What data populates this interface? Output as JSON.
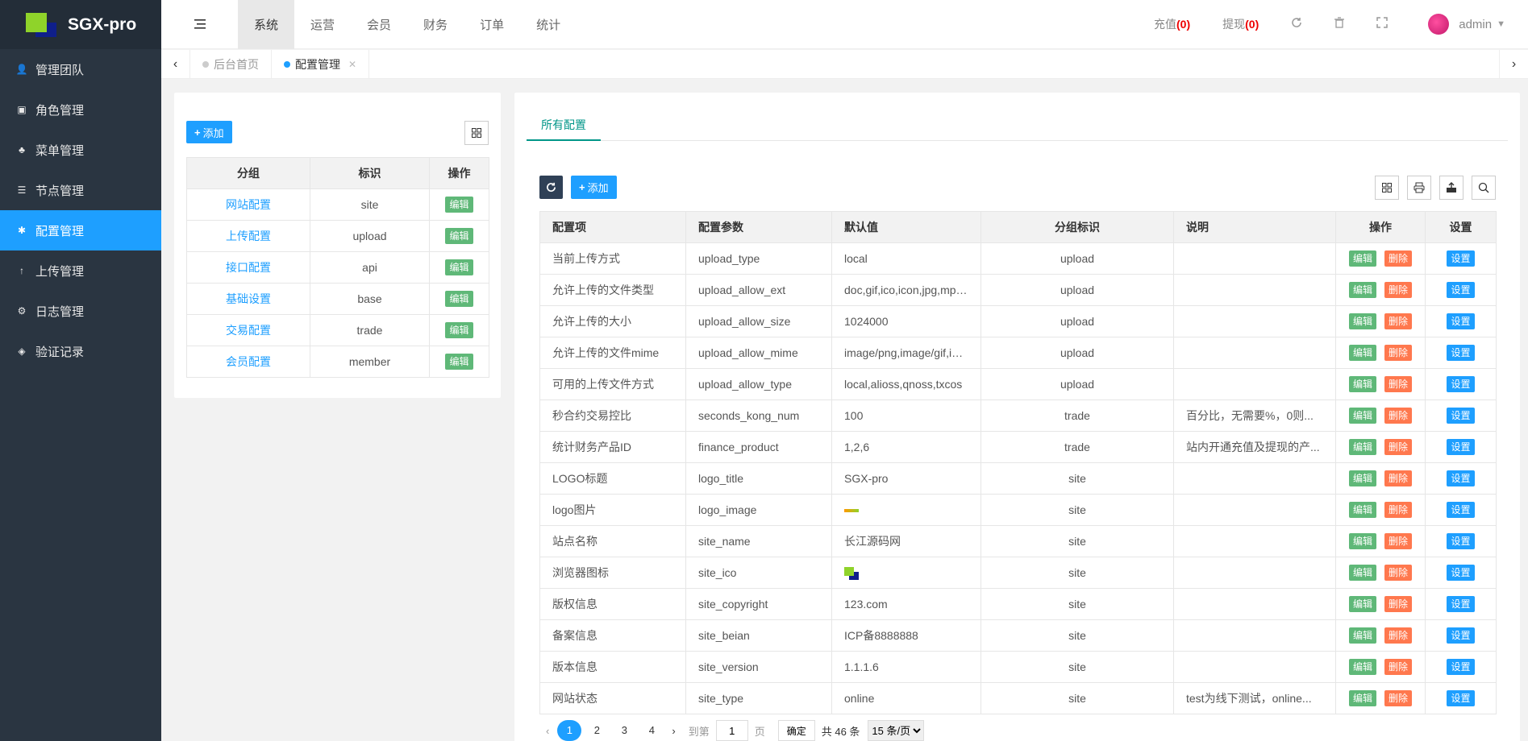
{
  "brand": {
    "name": "SGX-pro"
  },
  "sidebar": {
    "items": [
      {
        "label": "管理团队",
        "icon": "user-icon",
        "active": false
      },
      {
        "label": "角色管理",
        "icon": "role-icon",
        "active": false
      },
      {
        "label": "菜单管理",
        "icon": "tree-icon",
        "active": false
      },
      {
        "label": "节点管理",
        "icon": "list-icon",
        "active": false
      },
      {
        "label": "配置管理",
        "icon": "asterisk-icon",
        "active": true
      },
      {
        "label": "上传管理",
        "icon": "arrow-up-icon",
        "active": false
      },
      {
        "label": "日志管理",
        "icon": "gear-icon",
        "active": false
      },
      {
        "label": "验证记录",
        "icon": "cube-icon",
        "active": false
      }
    ]
  },
  "header": {
    "tabs": [
      {
        "label": "系统",
        "active": true
      },
      {
        "label": "运营",
        "active": false
      },
      {
        "label": "会员",
        "active": false
      },
      {
        "label": "财务",
        "active": false
      },
      {
        "label": "订单",
        "active": false
      },
      {
        "label": "统计",
        "active": false
      }
    ],
    "recharge_label": "充值",
    "recharge_count": "(0)",
    "withdraw_label": "提现",
    "withdraw_count": "(0)",
    "user": "admin"
  },
  "tabbar": {
    "tabs": [
      {
        "label": "后台首页",
        "active": false,
        "closable": false
      },
      {
        "label": "配置管理",
        "active": true,
        "closable": true
      }
    ]
  },
  "left_panel": {
    "add_label": "添加",
    "columns": [
      "分组",
      "标识",
      "操作"
    ],
    "edit_label": "编辑",
    "rows": [
      {
        "group": "网站配置",
        "key": "site"
      },
      {
        "group": "上传配置",
        "key": "upload"
      },
      {
        "group": "接口配置",
        "key": "api"
      },
      {
        "group": "基础设置",
        "key": "base"
      },
      {
        "group": "交易配置",
        "key": "trade"
      },
      {
        "group": "会员配置",
        "key": "member"
      }
    ]
  },
  "right_panel": {
    "tab_label": "所有配置",
    "add_label": "添加",
    "columns": [
      "配置项",
      "配置参数",
      "默认值",
      "分组标识",
      "说明",
      "操作",
      "设置"
    ],
    "edit_label": "编辑",
    "delete_label": "删除",
    "settings_label": "设置",
    "rows": [
      {
        "name": "当前上传方式",
        "param": "upload_type",
        "value": "local",
        "group": "upload",
        "desc": ""
      },
      {
        "name": "允许上传的文件类型",
        "param": "upload_allow_ext",
        "value": "doc,gif,ico,icon,jpg,mp3,...",
        "group": "upload",
        "desc": ""
      },
      {
        "name": "允许上传的大小",
        "param": "upload_allow_size",
        "value": "1024000",
        "group": "upload",
        "desc": ""
      },
      {
        "name": "允许上传的文件mime",
        "param": "upload_allow_mime",
        "value": "image/png,image/gif,ima...",
        "group": "upload",
        "desc": ""
      },
      {
        "name": "可用的上传文件方式",
        "param": "upload_allow_type",
        "value": "local,alioss,qnoss,txcos",
        "group": "upload",
        "desc": ""
      },
      {
        "name": "秒合约交易控比",
        "param": "seconds_kong_num",
        "value": "100",
        "group": "trade",
        "desc": "百分比，无需要%，0则..."
      },
      {
        "name": "统计财务产品ID",
        "param": "finance_product",
        "value": "1,2,6",
        "group": "trade",
        "desc": "站内开通充值及提现的产..."
      },
      {
        "name": "LOGO标题",
        "param": "logo_title",
        "value": "SGX-pro",
        "group": "site",
        "desc": ""
      },
      {
        "name": "logo图片",
        "param": "logo_image",
        "value": "",
        "image": "logo",
        "group": "site",
        "desc": ""
      },
      {
        "name": "站点名称",
        "param": "site_name",
        "value": "长江源码网",
        "group": "site",
        "desc": ""
      },
      {
        "name": "浏览器图标",
        "param": "site_ico",
        "value": "",
        "image": "ico",
        "group": "site",
        "desc": ""
      },
      {
        "name": "版权信息",
        "param": "site_copyright",
        "value": "123.com",
        "group": "site",
        "desc": ""
      },
      {
        "name": "备案信息",
        "param": "site_beian",
        "value": "ICP备8888888",
        "group": "site",
        "desc": ""
      },
      {
        "name": "版本信息",
        "param": "site_version",
        "value": "1.1.1.6",
        "group": "site",
        "desc": ""
      },
      {
        "name": "网站状态",
        "param": "site_type",
        "value": "online",
        "group": "site",
        "desc": "test为线下测试，online..."
      }
    ],
    "pager": {
      "pages": [
        "1",
        "2",
        "3",
        "4"
      ],
      "current": "1",
      "goto_label": "到第",
      "page_unit": "页",
      "goto_value": "1",
      "confirm_label": "确定",
      "total_text": "共 46 条",
      "page_size": "15 条/页"
    }
  }
}
